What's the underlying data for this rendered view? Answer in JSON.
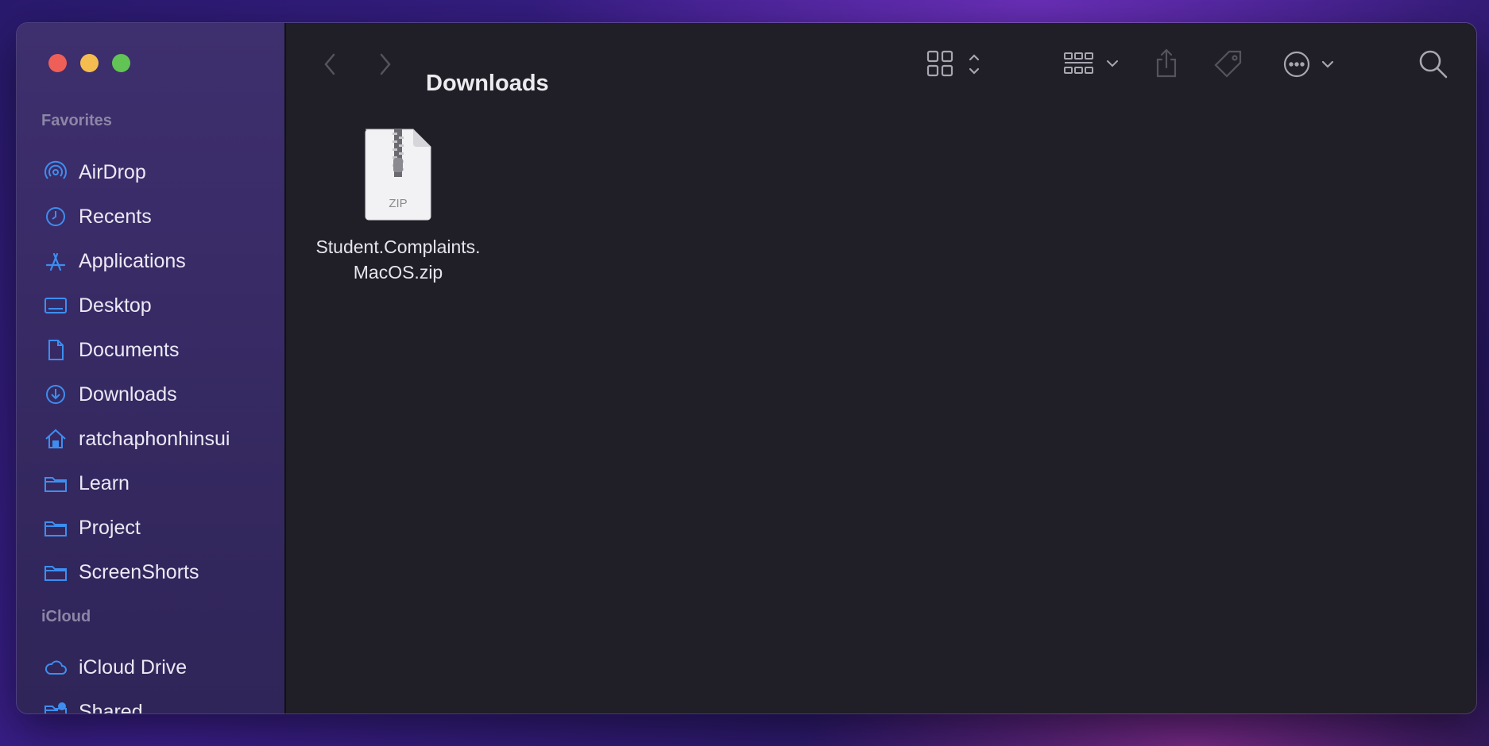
{
  "sidebar": {
    "favorites_label": "Favorites",
    "icloud_label": "iCloud",
    "favorites": [
      {
        "label": "AirDrop",
        "icon": "airdrop-icon"
      },
      {
        "label": "Recents",
        "icon": "clock-icon"
      },
      {
        "label": "Applications",
        "icon": "applications-icon"
      },
      {
        "label": "Desktop",
        "icon": "desktop-icon"
      },
      {
        "label": "Documents",
        "icon": "document-icon"
      },
      {
        "label": "Downloads",
        "icon": "download-icon"
      },
      {
        "label": "ratchaphonhinsui",
        "icon": "home-icon"
      },
      {
        "label": "Learn",
        "icon": "folder-icon"
      },
      {
        "label": "Project",
        "icon": "folder-icon"
      },
      {
        "label": "ScreenShorts",
        "icon": "folder-icon"
      }
    ],
    "icloud": [
      {
        "label": "iCloud Drive",
        "icon": "cloud-icon"
      },
      {
        "label": "Shared",
        "icon": "shared-folder-icon"
      }
    ]
  },
  "toolbar": {
    "title": "Downloads",
    "icons": [
      "back-icon",
      "forward-icon",
      "icon-view-icon",
      "group-icon",
      "share-icon",
      "tag-icon",
      "more-icon",
      "search-icon"
    ]
  },
  "files": [
    {
      "name": "Student.Complaints.MacOS.zip",
      "badge": "ZIP",
      "icon": "zip-archive-icon"
    }
  ],
  "colors": {
    "accent": "#3d8ef0",
    "sidebar_bg": "#3a2c68",
    "content_bg": "#201e26",
    "close": "#ee5f57",
    "minimize": "#f5bd4f",
    "zoom": "#61c454"
  }
}
